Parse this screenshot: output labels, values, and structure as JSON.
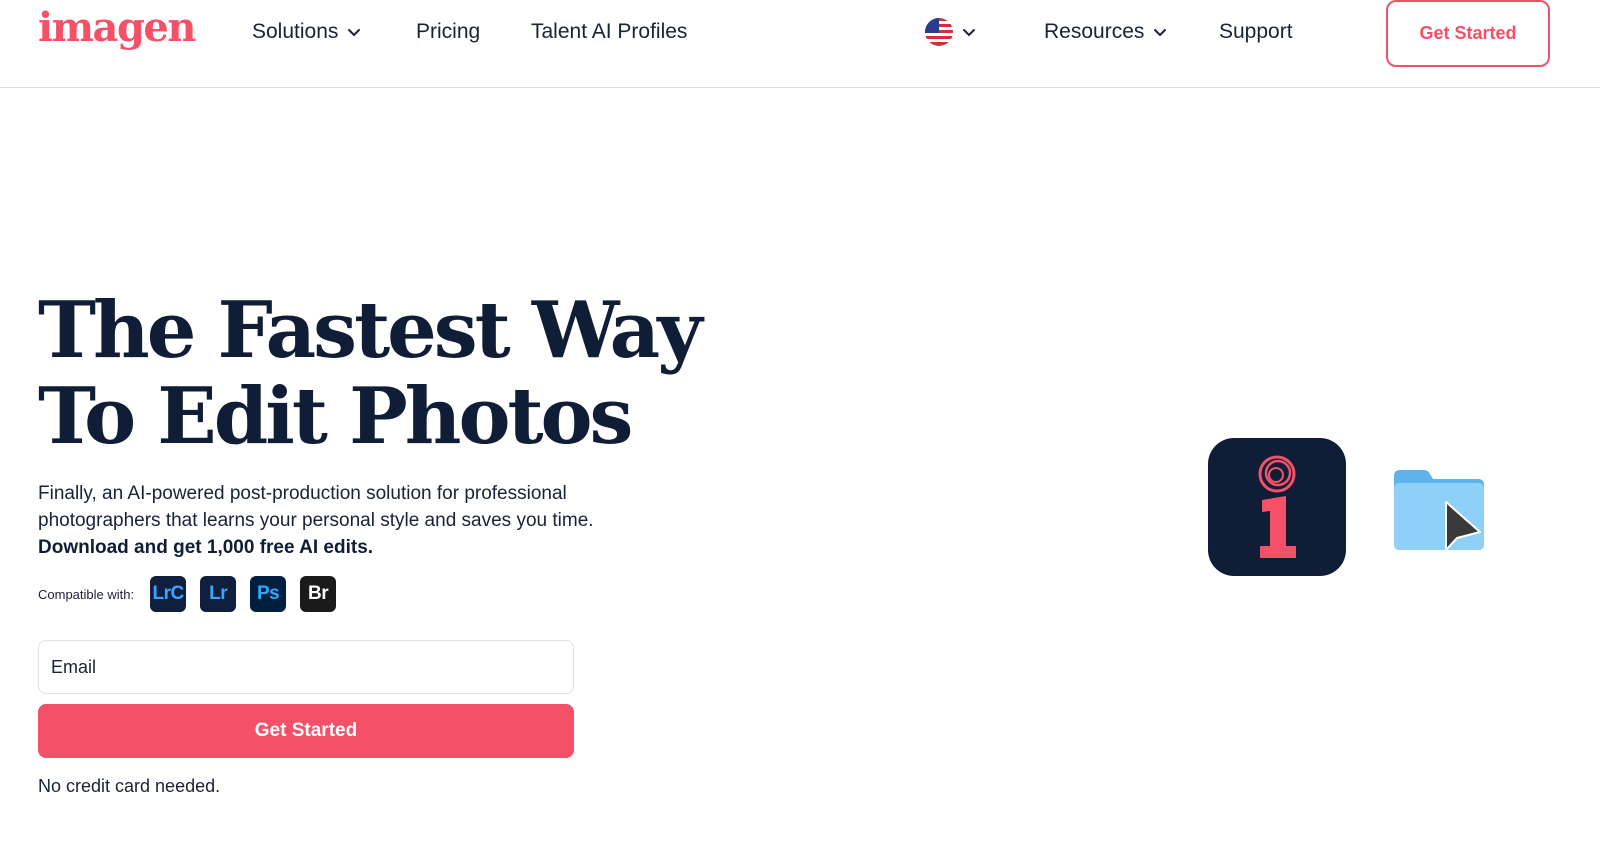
{
  "header": {
    "logo_text": "imagen",
    "nav": [
      {
        "label": "Solutions",
        "has_dropdown": true
      },
      {
        "label": "Pricing",
        "has_dropdown": false
      },
      {
        "label": "Talent AI Profiles",
        "has_dropdown": false
      }
    ],
    "language_icon": "us-flag-icon",
    "right_nav": [
      {
        "label": "Resources",
        "has_dropdown": true
      },
      {
        "label": "Support",
        "has_dropdown": false
      }
    ],
    "cta_label": "Get Started"
  },
  "hero": {
    "title_line1": "The Fastest Way",
    "title_line2": "To Edit Photos",
    "subtitle": "Finally, an AI-powered post-production solution for professional photographers that learns your personal style and saves you time.",
    "subtitle_bold": "Download and get 1,000 free AI edits.",
    "compatible_label": "Compatible with:",
    "compatible_apps": [
      {
        "label": "LrC",
        "icon": "lightroom-classic-icon"
      },
      {
        "label": "Lr",
        "icon": "lightroom-icon"
      },
      {
        "label": "Ps",
        "icon": "photoshop-icon"
      },
      {
        "label": "Br",
        "icon": "bridge-icon"
      }
    ],
    "email_placeholder": "Email",
    "cta_label": "Get Started",
    "note": "No credit card needed."
  },
  "illustrations": {
    "app_icon": "imagen-app-icon",
    "folder_icon": "folder-icon",
    "cursor_icon": "cursor-arrow-icon"
  },
  "colors": {
    "brand": "#f45068",
    "navy": "#101d36",
    "folder": "#7cc4f5"
  }
}
